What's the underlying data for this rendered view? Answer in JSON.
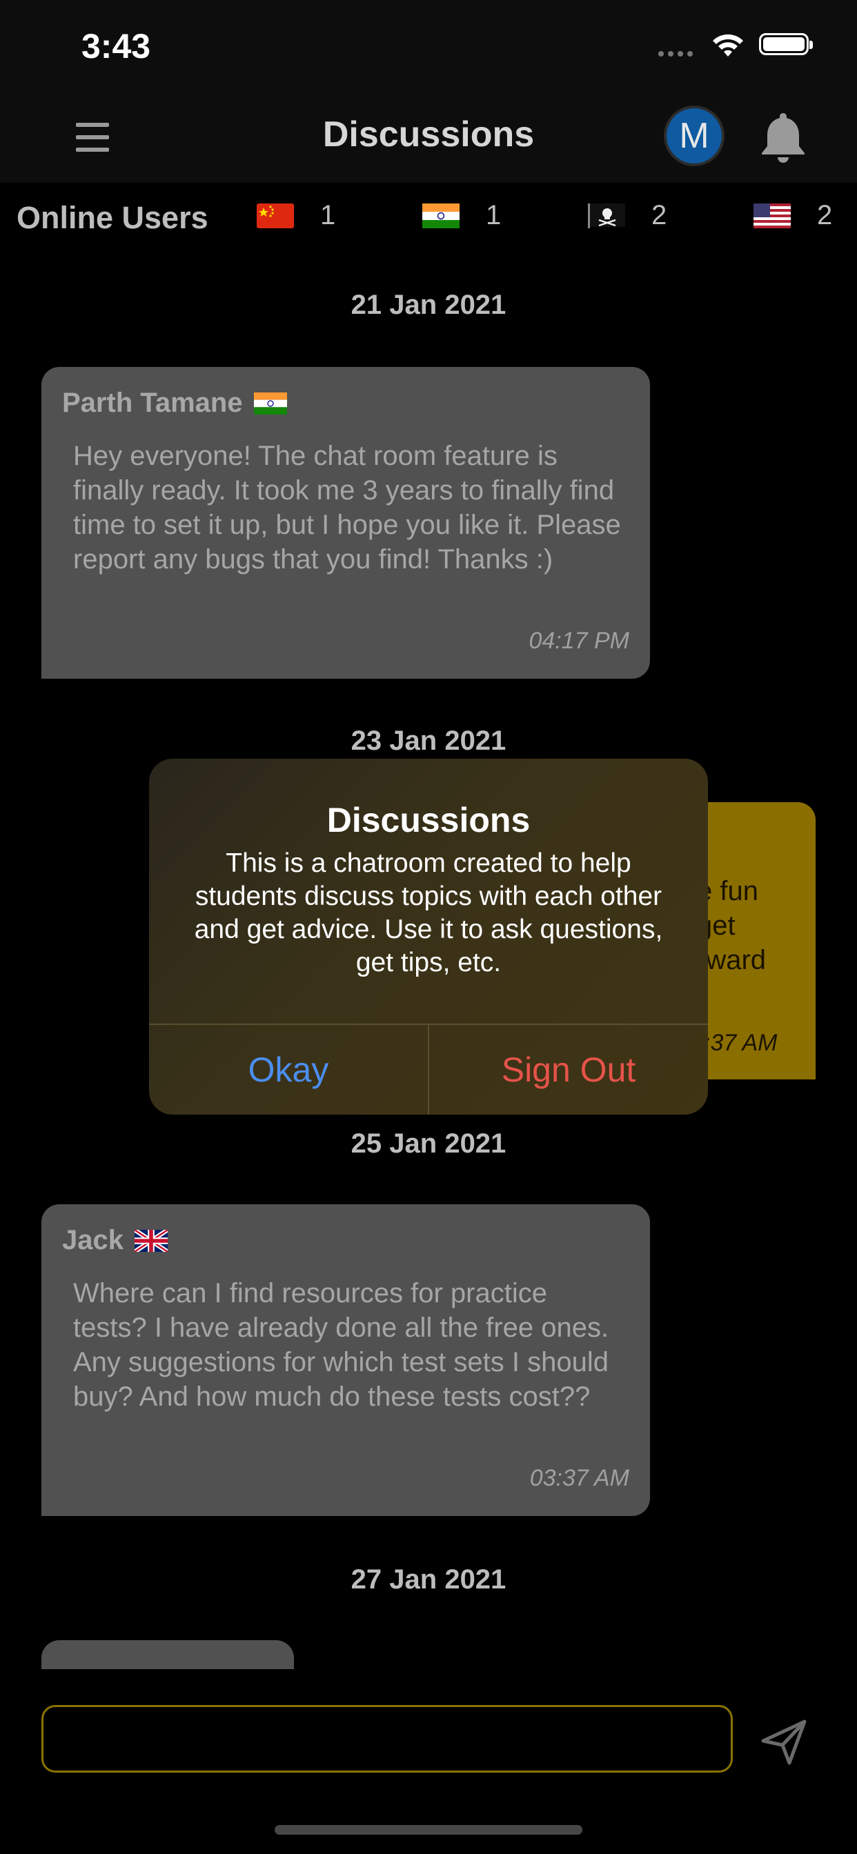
{
  "status_bar": {
    "time": "3:43"
  },
  "nav": {
    "title": "Discussions",
    "avatar_initial": "M"
  },
  "online_users": {
    "label": "Online Users",
    "items": [
      {
        "flag": "china-flag",
        "count": "1"
      },
      {
        "flag": "india-flag",
        "count": "1"
      },
      {
        "flag": "pirate-flag",
        "count": "2"
      },
      {
        "flag": "usa-flag",
        "count": "2"
      }
    ]
  },
  "dates": [
    "21 Jan 2021",
    "23 Jan 2021",
    "25 Jan 2021",
    "27 Jan 2021"
  ],
  "messages": [
    {
      "sender": "Parth Tamane",
      "flag": "india-flag",
      "text": "Hey everyone! The chat room feature is finally ready. It took me 3 years to finally find time to set it up, but I hope you like it. Please report any bugs that you find! Thanks :)",
      "time": "04:17 PM"
    },
    {
      "own": true,
      "visible_text_fragments": [
        "e fun",
        "get",
        "rward"
      ],
      "time": ":37 AM"
    },
    {
      "sender": "Jack",
      "flag": "uk-flag",
      "text": "Where can I find resources for practice tests? I have already done all the free ones. Any suggestions for which test sets I should buy? And how much do these tests cost??",
      "time": "03:37 AM"
    }
  ],
  "alert": {
    "title": "Discussions",
    "message": "This is a chatroom created to help students discuss topics with each other and get advice. Use it to ask questions, get tips, etc.",
    "buttons": {
      "okay": "Okay",
      "sign_out": "Sign Out"
    }
  },
  "composer": {
    "value": "",
    "placeholder": ""
  },
  "colors": {
    "accent_yellow": "#8b6e00",
    "alert_okay": "#4c8ef0",
    "alert_signout": "#e6534a",
    "avatar_blue": "#0f5aa0"
  }
}
